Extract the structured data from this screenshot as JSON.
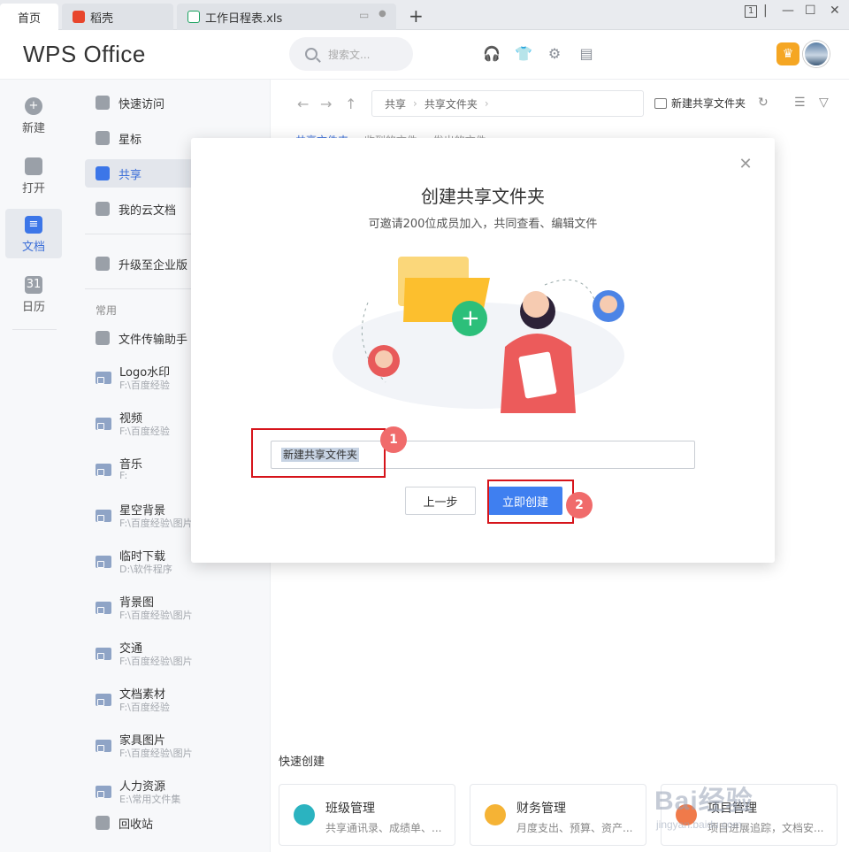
{
  "tabs": [
    {
      "label": "首页"
    },
    {
      "label": "稻壳"
    },
    {
      "label": "工作日程表.xls"
    }
  ],
  "window": {
    "page_count": "1"
  },
  "header": {
    "logo": "WPS Office",
    "search_placeholder": "搜索文..."
  },
  "rail": [
    {
      "label": "新建"
    },
    {
      "label": "打开"
    },
    {
      "label": "文档"
    },
    {
      "label": "日历",
      "glyph": "31"
    }
  ],
  "nav": {
    "top": [
      {
        "label": "快速访问"
      },
      {
        "label": "星标"
      },
      {
        "label": "共享"
      },
      {
        "label": "我的云文档"
      }
    ],
    "upgrade": "升级至企业版",
    "section": "常用",
    "transfer": "文件传输助手",
    "folders": [
      {
        "name": "Logo水印",
        "path": "F:\\百度经验"
      },
      {
        "name": "视频",
        "path": "F:\\百度经验"
      },
      {
        "name": "音乐",
        "path": "F:"
      },
      {
        "name": "星空背景",
        "path": "F:\\百度经验\\图片"
      },
      {
        "name": "临时下载",
        "path": "D:\\软件程序"
      },
      {
        "name": "背景图",
        "path": "F:\\百度经验\\图片"
      },
      {
        "name": "交通",
        "path": "F:\\百度经验\\图片"
      },
      {
        "name": "文档素材",
        "path": "F:\\百度经验"
      },
      {
        "name": "家具图片",
        "path": "F:\\百度经验\\图片"
      },
      {
        "name": "人力资源",
        "path": "E:\\常用文件集"
      }
    ],
    "recycle": "回收站"
  },
  "main": {
    "breadcrumb": [
      "共享",
      "共享文件夹"
    ],
    "new_share": "新建共享文件夹",
    "subtabs": [
      "共享文件夹",
      "收到的文件",
      "发出的文件"
    ],
    "quick_create": "快速创建",
    "cards": [
      {
        "title": "班级管理",
        "desc": "共享通讯录、成绩单、...",
        "color": "#2bb3c0"
      },
      {
        "title": "财务管理",
        "desc": "月度支出、预算、资产...",
        "color": "#f5b335"
      },
      {
        "title": "项目管理",
        "desc": "项目进展追踪，文档安...",
        "color": "#f07a4a"
      }
    ]
  },
  "modal": {
    "title": "创建共享文件夹",
    "subtitle": "可邀请200位成员加入，共同查看、编辑文件",
    "input_value": "新建共享文件夹",
    "back_button": "上一步",
    "create_button": "立即创建",
    "badge_1": "1",
    "badge_2": "2"
  },
  "watermark": {
    "text": "Bai经验",
    "sub": "jingyan.baidu.com"
  },
  "colors": {
    "accent": "#3f7ff0",
    "highlight": "#d6141b",
    "badge": "#f06b6b"
  }
}
